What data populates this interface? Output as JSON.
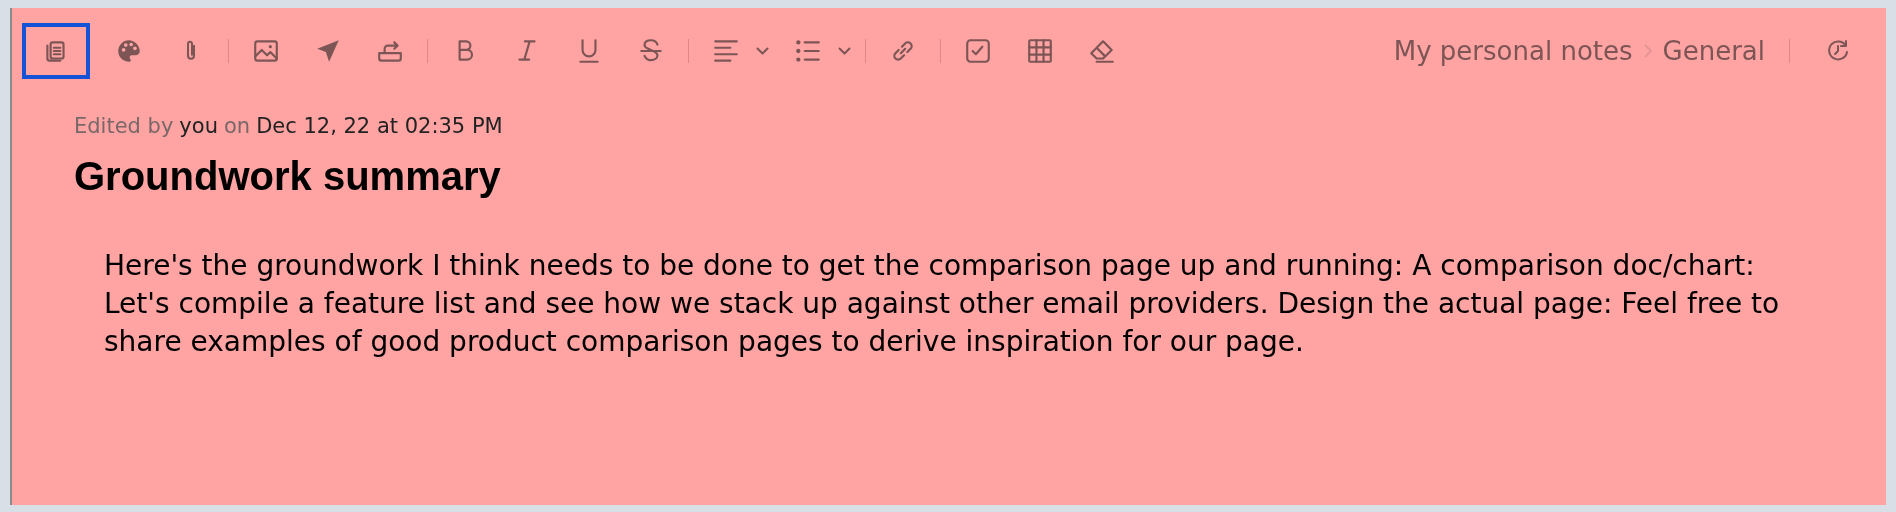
{
  "toolbar": {
    "groups": [
      [
        {
          "kind": "notebook",
          "selected": true
        },
        {
          "kind": "palette",
          "selected": false
        },
        {
          "kind": "attach",
          "selected": false
        }
      ],
      [
        {
          "kind": "image",
          "selected": false
        },
        {
          "kind": "send",
          "selected": false
        },
        {
          "kind": "export",
          "selected": false
        }
      ],
      [
        {
          "kind": "bold",
          "selected": false
        },
        {
          "kind": "italic",
          "selected": false
        },
        {
          "kind": "underline",
          "selected": false
        },
        {
          "kind": "strike",
          "selected": false
        }
      ],
      [
        {
          "kind": "align",
          "selected": false
        },
        {
          "kind": "caret",
          "selected": false
        },
        {
          "kind": "list",
          "selected": false
        },
        {
          "kind": "caret",
          "selected": false
        }
      ],
      [
        {
          "kind": "link",
          "selected": false
        }
      ],
      [
        {
          "kind": "checkbox",
          "selected": false
        },
        {
          "kind": "table",
          "selected": false
        },
        {
          "kind": "eraser",
          "selected": false
        }
      ]
    ]
  },
  "breadcrumb": [
    "My personal notes",
    "General"
  ],
  "edited": {
    "prefix": "Edited by",
    "user": "you",
    "joiner": "on",
    "date": "Dec 12, 22 at 02:35 PM"
  },
  "title": "Groundwork summary",
  "body": "Here's the groundwork I think needs to be done to get the comparison page up and running: A comparison doc/chart: Let's compile a feature list and see how we stack up against other email providers. Design the actual page: Feel free to share examples of good product comparison pages to derive inspiration for our page."
}
